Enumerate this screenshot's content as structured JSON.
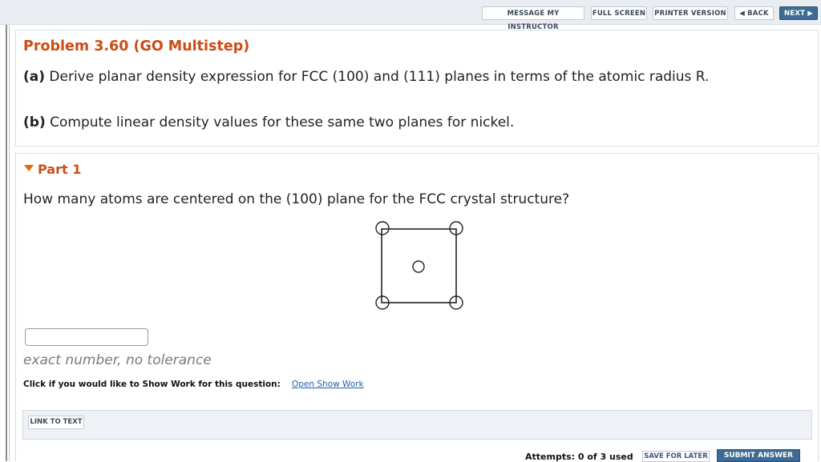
{
  "toolbar": {
    "message_instructor": "MESSAGE MY INSTRUCTOR",
    "full_screen": "FULL SCREEN",
    "printer_version": "PRINTER VERSION",
    "back": "◀ BACK",
    "next": "NEXT ▶"
  },
  "problem": {
    "title": "Problem 3.60 (GO Multistep)",
    "part_a_label": "(a)",
    "part_a_text": "Derive planar density expression for FCC (100) and (111) planes in terms of the atomic radius R.",
    "part_b_label": "(b)",
    "part_b_text": "Compute linear density values for these same two planes for nickel."
  },
  "part1": {
    "title": "Part 1",
    "question": "How many atoms are centered on the (100) plane for the FCC crystal structure?",
    "answer_value": "",
    "hint": "exact number, no tolerance",
    "show_work_label": "Click if you would like to Show Work for this question:",
    "show_work_link": "Open Show Work",
    "link_to_text": "LINK TO TEXT"
  },
  "footer": {
    "attempts": "Attempts: 0 of 3 used",
    "save_later": "SAVE FOR LATER",
    "submit": "SUBMIT ANSWER"
  },
  "colors": {
    "accent_orange": "#cc4c15",
    "toolbar_bg": "#e9edf1",
    "primary_button": "#3d6b93",
    "link_blue": "#1f5fa8"
  }
}
